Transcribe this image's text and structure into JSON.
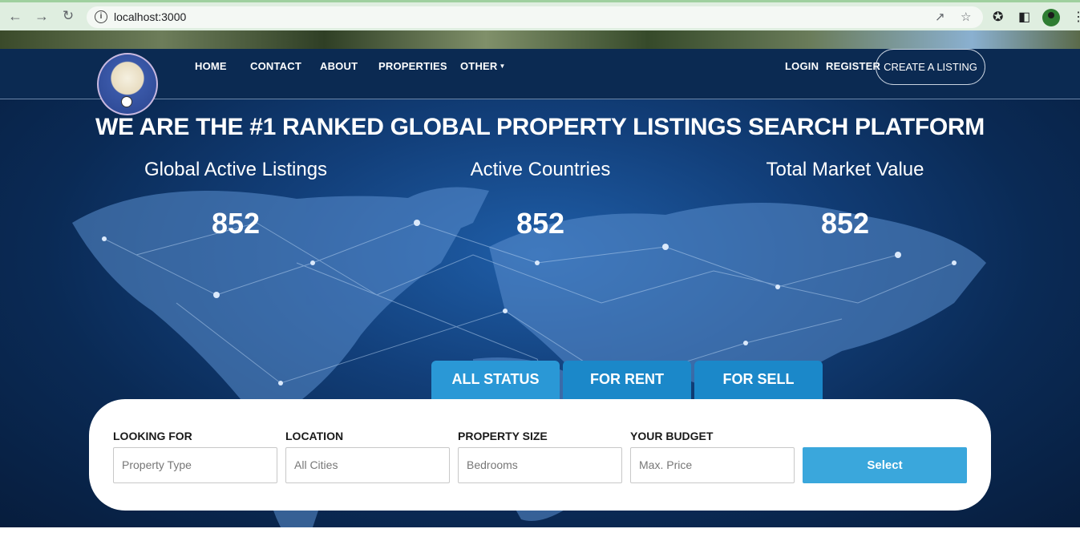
{
  "browser": {
    "url": "localhost:3000"
  },
  "nav": {
    "home": "HOME",
    "contact": "CONTACT",
    "about": "ABOUT",
    "properties": "PROPERTIES",
    "other": "OTHER",
    "login": "LOGIN",
    "register": "REGISTER",
    "create_listing": "CREATE A LISTING"
  },
  "hero": {
    "title": "WE ARE THE #1 RANKED GLOBAL PROPERTY LISTINGS SEARCH PLATFORM",
    "stats": [
      {
        "label": "Global Active Listings",
        "value": "852"
      },
      {
        "label": "Active Countries",
        "value": "852"
      },
      {
        "label": "Total Market Value",
        "value": "852"
      }
    ]
  },
  "tabs": [
    "ALL STATUS",
    "FOR RENT",
    "FOR SELL"
  ],
  "search": {
    "fields": [
      {
        "label": "LOOKING FOR",
        "placeholder": "Property Type"
      },
      {
        "label": "LOCATION",
        "placeholder": "All Cities"
      },
      {
        "label": "PROPERTY SIZE",
        "placeholder": "Bedrooms"
      },
      {
        "label": "YOUR BUDGET",
        "placeholder": "Max. Price"
      }
    ],
    "button": "Select"
  },
  "colors": {
    "navbar": "#0b2a52",
    "tab": "#1b88c9",
    "button": "#3aa7dc"
  }
}
